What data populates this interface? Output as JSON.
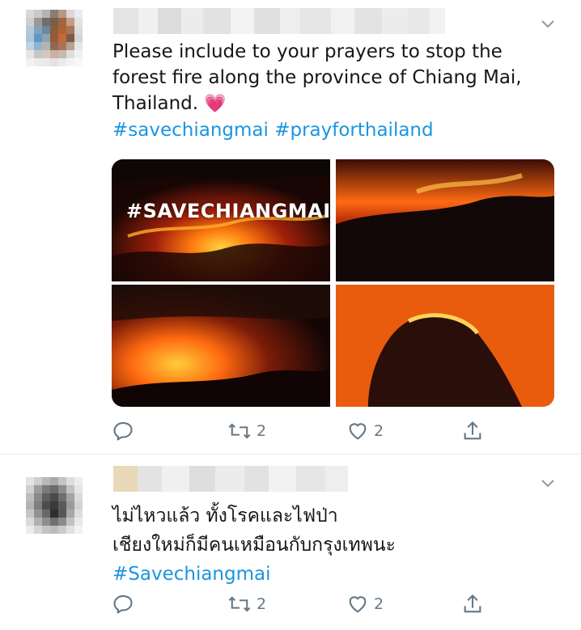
{
  "tweets": [
    {
      "text_lines": [
        "Please include to your prayers to stop the",
        "forest fire along the province of Chiang Mai,",
        "Thailand."
      ],
      "emoji": "💗",
      "hashtags": [
        "#savechiangmai",
        "#prayforthailand"
      ],
      "media_overlay_text": "#SAVECHIANGMAI",
      "retweet_count": "2",
      "like_count": "2"
    },
    {
      "text_lines": [
        "ไม่ไหวแล้ว ทั้งโรคและไฟป่า",
        "เชียงใหม่ก็มีคนเหมือนกับกรุงเทพนะ"
      ],
      "hashtags": [
        "#Savechiangmai"
      ],
      "retweet_count": "2",
      "like_count": "2"
    }
  ],
  "colors": {
    "link": "#1b95e0",
    "action_gray": "#657786",
    "divider": "#e6ecf0"
  },
  "icons": {
    "reply": "reply-icon",
    "retweet": "retweet-icon",
    "like": "heart-icon",
    "share": "share-icon",
    "menu": "chevron-down-icon"
  }
}
